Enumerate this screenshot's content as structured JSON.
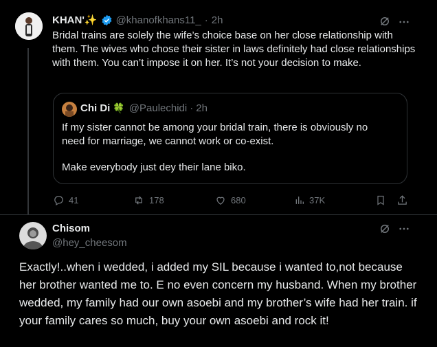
{
  "tweet1": {
    "name": "KHAN'✨",
    "handle": "@khanofkhans11_",
    "sep": "·",
    "time": "2h",
    "text": "Bridal trains are solely the wife’s choice base on her close relationship with them. The wives who chose their sister in laws definitely had close relationships with them. You can’t impose it on her. It’s not your decision to make.",
    "quote": {
      "name": "Chi Di",
      "emoji": "🍀",
      "handle": "@Paulechidi",
      "sep": "·",
      "time": "2h",
      "line1": "If my sister cannot be among your bridal train, there is obviously no need for marriage, we cannot work or co-exist.",
      "line2": "Make everybody just dey their lane biko."
    },
    "stats": {
      "replies": "41",
      "reposts": "178",
      "likes": "680",
      "views": "37K"
    }
  },
  "tweet2": {
    "name": "Chisom",
    "handle": "@hey_cheesom",
    "text": "Exactly!..when i wedded, i added my SIL because i wanted to,not because her brother wanted me to. E no even concern my husband. When my brother wedded, my family had our own asoebi and my brother’s wife had her train. if your family cares so much, buy your own asoebi and rock it!"
  },
  "icons": [
    "grok-icon",
    "more-icon",
    "reply-icon",
    "repost-icon",
    "like-icon",
    "views-icon",
    "bookmark-icon",
    "share-icon",
    "verified-icon"
  ],
  "colors": {
    "verified": "#1d9bf0",
    "muted": "#71767b",
    "border": "#2f3336"
  }
}
